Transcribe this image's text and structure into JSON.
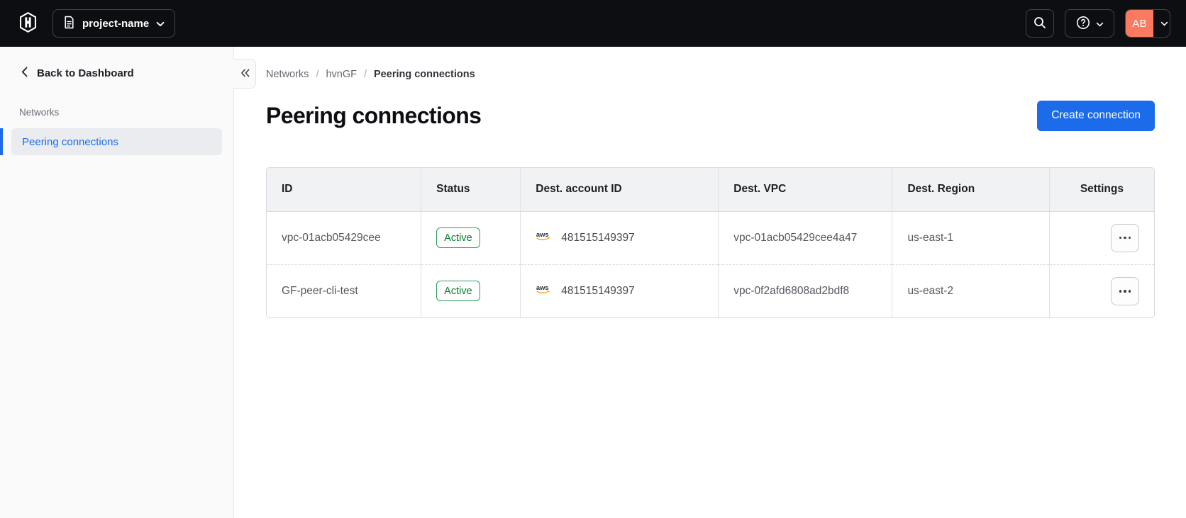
{
  "topbar": {
    "project_switcher_label": "project-name",
    "avatar_initials": "AB"
  },
  "sidebar": {
    "back_label": "Back to Dashboard",
    "section_label": "Networks",
    "active_item_label": "Peering connections",
    "collapse_glyph": "«"
  },
  "breadcrumb": {
    "separator": "/",
    "items": [
      {
        "label": "Networks"
      },
      {
        "label": "hvnGF"
      },
      {
        "label": "Peering connections"
      }
    ]
  },
  "page": {
    "title": "Peering connections",
    "create_button_label": "Create connection"
  },
  "table": {
    "columns": [
      "ID",
      "Status",
      "Dest. account ID",
      "Dest. VPC",
      "Dest. Region",
      "Settings"
    ],
    "rows": [
      {
        "id": "vpc-01acb05429cee",
        "status": "Active",
        "dest_account_id": "481515149397",
        "dest_vpc": "vpc-01acb05429cee4a47",
        "dest_region": "us-east-1"
      },
      {
        "id": "GF-peer-cli-test",
        "status": "Active",
        "dest_account_id": "481515149397",
        "dest_vpc": "vpc-0f2afd6808ad2bdf8",
        "dest_region": "us-east-2"
      }
    ]
  },
  "colors": {
    "topbar_bg": "#0d0e12",
    "accent_blue": "#1c6beb",
    "avatar_orange": "#f97a61",
    "badge_green_border": "#2f9e60",
    "badge_green_text": "#0e7a34",
    "aws_orange": "#ff9900",
    "sidebar_bg": "#fafafb",
    "table_header_bg": "#f1f2f4"
  }
}
